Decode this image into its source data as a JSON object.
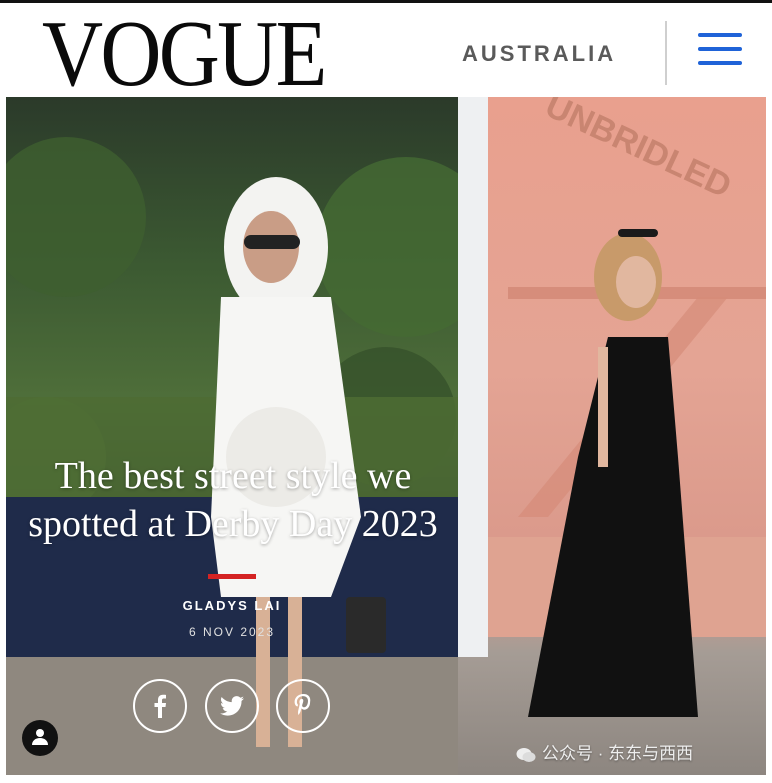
{
  "header": {
    "logo": "VOGUE",
    "region": "AUSTRALIA",
    "menu_icon": "hamburger-menu-icon",
    "accent_color": "#1f63d8"
  },
  "article": {
    "headline_line1": "The best street style we",
    "headline_line2": "spotted at Derby Day 2023",
    "author": "GLADYS LAI",
    "date": "6 NOV 2023",
    "accent_bar_color": "#d42323"
  },
  "share": [
    {
      "icon": "facebook-icon"
    },
    {
      "icon": "twitter-icon"
    },
    {
      "icon": "pinterest-icon"
    }
  ],
  "user_button": {
    "icon": "user-icon"
  },
  "backdrop": {
    "sign_text": "UNBRIDLED"
  },
  "watermark": "公众号 · 东东与西西"
}
